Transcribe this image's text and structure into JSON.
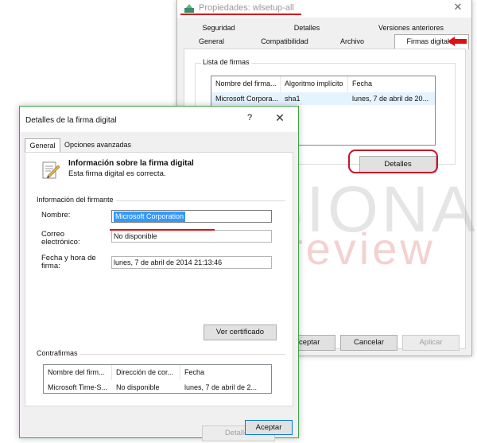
{
  "props_window": {
    "title": "Propiedades: wlsetup-all",
    "close": "✕",
    "tabs_top": [
      "Seguridad",
      "Detalles",
      "Versiones anteriores"
    ],
    "tabs_bottom": [
      "General",
      "Compatibilidad",
      "Archivo",
      "Firmas digitales"
    ],
    "active_tab": "Firmas digitales",
    "signature_list_label": "Lista de firmas",
    "columns": [
      "Nombre del firma...",
      "Algoritmo implícito",
      "Fecha"
    ],
    "rows": [
      [
        "Microsoft Corpora...",
        "sha1",
        "lunes, 7 de abril de 20..."
      ]
    ],
    "details_button": "Detalles",
    "accept": "Aceptar",
    "cancel": "Cancelar",
    "apply": "Aplicar"
  },
  "details_dialog": {
    "title": "Detalles de la firma digital",
    "help": "?",
    "close": "✕",
    "tabs": [
      "General",
      "Opciones avanzadas"
    ],
    "info_title": "Información sobre la firma digital",
    "info_desc": "Esta firma digital es correcta.",
    "signer_group_label": "Información del firmante",
    "name_label": "Nombre:",
    "name_value": "Microsoft Corporation",
    "email_label_1": "Correo",
    "email_label_2": "electrónico:",
    "email_value": "No disponible",
    "date_label_1": "Fecha y hora de",
    "date_label_2": "firma:",
    "date_value": "lunes, 7 de abril de 2014 21:13:46",
    "view_cert_button": "Ver certificado",
    "countersign_label": "Contrafirmas",
    "counter_columns": [
      "Nombre del firm...",
      "Dirección de cor...",
      "Fecha"
    ],
    "counter_rows": [
      [
        "Microsoft Time-S...",
        "No disponible",
        "lunes, 7 de abril de 2..."
      ]
    ],
    "details_button": "Detalles",
    "accept": "Aceptar"
  },
  "watermark": {
    "line1": "PROFESIONAL",
    "line2": "review"
  },
  "colors": {
    "annotation_red": "#c8102e",
    "selection_blue": "#3399ff",
    "dialog_border": "#41a348"
  }
}
